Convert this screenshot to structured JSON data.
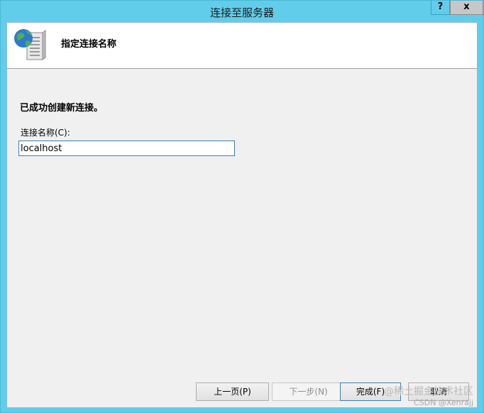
{
  "window": {
    "title": "连接至服务器",
    "help_glyph": "?",
    "close_glyph": "x"
  },
  "header": {
    "icon": "server-globe-icon",
    "title": "指定连接名称"
  },
  "main": {
    "success_message": "已成功创建新连接。",
    "name_label": "连接名称(C):",
    "name_value": "localhost"
  },
  "buttons": {
    "previous": "上一页(P)",
    "next": "下一步(N)",
    "finish": "完成(F)",
    "cancel": "取消"
  },
  "watermark": {
    "line1": "@稀土掘金技术社区",
    "line2": "CSDN @Xenrajj"
  },
  "colors": {
    "titlebar": "#62cdea",
    "dialog_background": "#f0f0f0",
    "input_border": "#3c7fb1"
  }
}
